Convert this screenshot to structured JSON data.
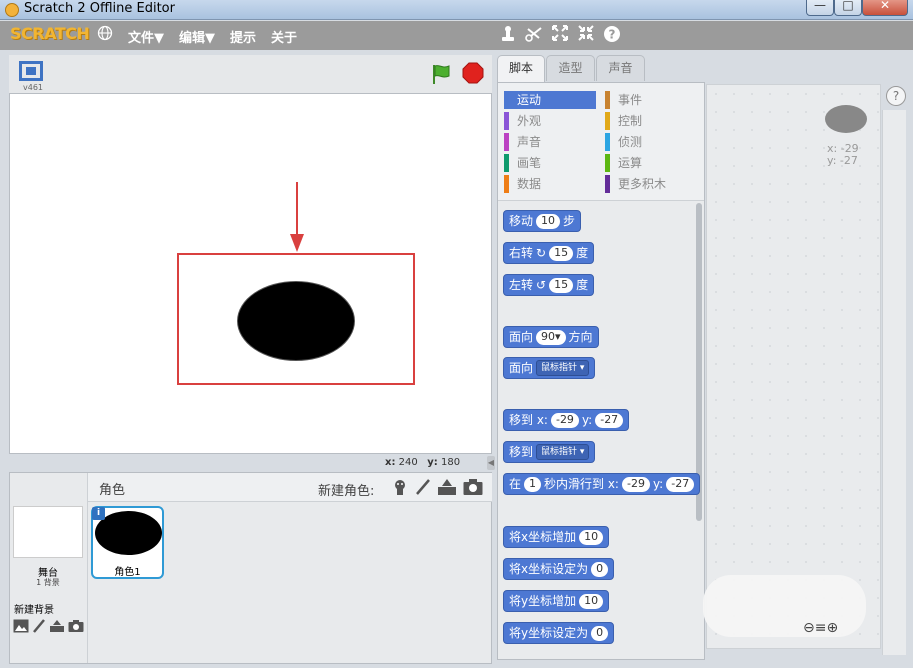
{
  "window": {
    "title": "Scratch 2 Offline Editor",
    "min": "—",
    "max": "□",
    "close": "✕"
  },
  "menubar": {
    "logo": "SCRATCH",
    "file": "文件▼",
    "edit": "编辑▼",
    "tips": "提示",
    "about": "关于"
  },
  "stage": {
    "version": "v461",
    "coord_x_label": "x:",
    "coord_x": "240",
    "coord_y_label": "y:",
    "coord_y": "180"
  },
  "sprites": {
    "header": "角色",
    "new_sprite_label": "新建角色:",
    "stage_label": "舞台",
    "stage_backdrops": "1 背景",
    "new_backdrop_label": "新建背景",
    "items": [
      {
        "name": "角色1"
      }
    ]
  },
  "tabs": {
    "scripts": "脚本",
    "costumes": "造型",
    "sounds": "声音"
  },
  "categories": [
    {
      "label": "运动",
      "color": "#4c78d2",
      "selected": true
    },
    {
      "label": "事件",
      "color": "#c88330"
    },
    {
      "label": "外观",
      "color": "#8a55d7"
    },
    {
      "label": "控制",
      "color": "#e1a91a"
    },
    {
      "label": "声音",
      "color": "#bb42c3"
    },
    {
      "label": "侦测",
      "color": "#2ca5e2"
    },
    {
      "label": "画笔",
      "color": "#0e9a6c"
    },
    {
      "label": "运算",
      "color": "#5cb712"
    },
    {
      "label": "数据",
      "color": "#ee7d16"
    },
    {
      "label": "更多积木",
      "color": "#632d99"
    }
  ],
  "blocks": {
    "move": {
      "pre": "移动",
      "val": "10",
      "post": "步"
    },
    "turn_right": {
      "pre": "右转",
      "icon": "↻",
      "val": "15",
      "post": "度"
    },
    "turn_left": {
      "pre": "左转",
      "icon": "↺",
      "val": "15",
      "post": "度"
    },
    "point_dir": {
      "pre": "面向",
      "val": "90▾",
      "post": "方向"
    },
    "point_towards": {
      "pre": "面向",
      "dd": "鼠标指针 ▾"
    },
    "goto_xy": {
      "pre": "移到 x:",
      "x": "-29",
      "mid": "y:",
      "y": "-27"
    },
    "goto": {
      "pre": "移到",
      "dd": "鼠标指针 ▾"
    },
    "glide": {
      "pre": "在",
      "secs": "1",
      "mid": "秒内滑行到 x:",
      "x": "-29",
      "ylabel": "y:",
      "y": "-27"
    },
    "change_x": {
      "pre": "将x坐标增加",
      "val": "10"
    },
    "set_x": {
      "pre": "将x坐标设定为",
      "val": "0"
    },
    "change_y": {
      "pre": "将y坐标增加",
      "val": "10"
    },
    "set_y": {
      "pre": "将y坐标设定为",
      "val": "0"
    }
  },
  "script_area": {
    "x_label": "x:",
    "x": "-29",
    "y_label": "y:",
    "y": "-27"
  },
  "help": "?"
}
